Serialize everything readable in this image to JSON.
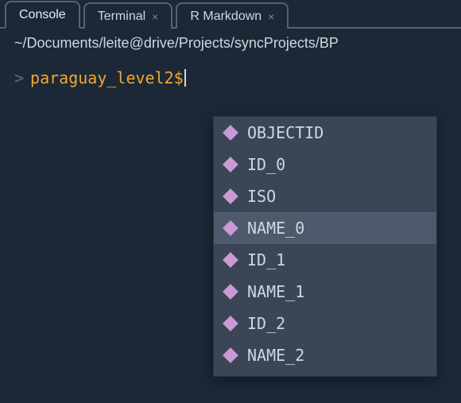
{
  "tabs": [
    {
      "label": "Console",
      "active": true,
      "closable": false
    },
    {
      "label": "Terminal",
      "active": false,
      "closable": true
    },
    {
      "label": "R Markdown",
      "active": false,
      "closable": true
    }
  ],
  "path": "~/Documents/leite@drive/Projects/syncProjects/BP",
  "prompt": {
    "symbol": ">",
    "input": "paraguay_level2$"
  },
  "autocomplete": {
    "selected_index": 3,
    "items": [
      "OBJECTID",
      "ID_0",
      "ISO",
      "NAME_0",
      "ID_1",
      "NAME_1",
      "ID_2",
      "NAME_2"
    ]
  },
  "colors": {
    "background": "#1c2836",
    "prompt_input": "#f0a830",
    "ac_icon": "#c99bd6"
  },
  "chart_data": null
}
